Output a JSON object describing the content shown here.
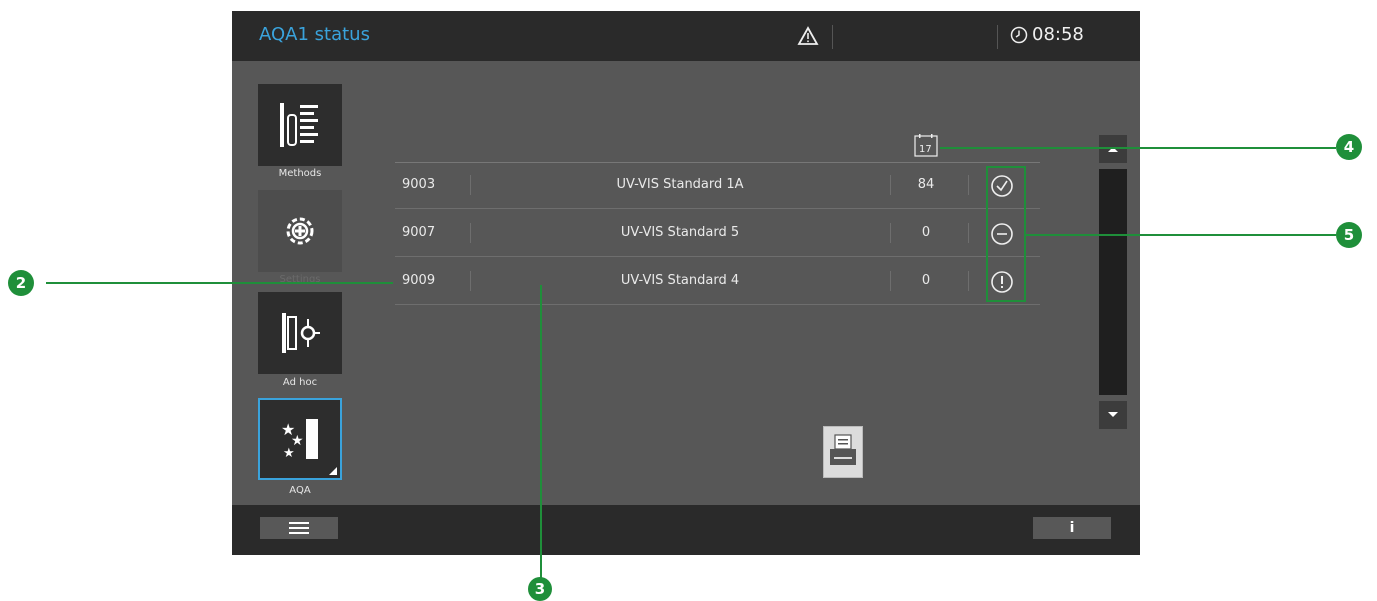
{
  "header": {
    "title": "AQA1 status",
    "time": "08:58",
    "warning_icon": "warning-triangle-icon",
    "clock_icon": "clock-icon"
  },
  "sidebar": {
    "items": [
      {
        "label": "Methods",
        "icon": "methods-icon"
      },
      {
        "label": "Settings",
        "icon": "settings-gear-icon"
      },
      {
        "label": "Ad hoc",
        "icon": "ad-hoc-icon"
      },
      {
        "label": "AQA",
        "icon": "aqa-stars-icon",
        "active": true
      }
    ]
  },
  "table": {
    "date_header": "17",
    "rows": [
      {
        "id": "9003",
        "name": "UV-VIS Standard 1A",
        "days": "84",
        "status": "ok"
      },
      {
        "id": "9007",
        "name": "UV-VIS Standard 5",
        "days": "0",
        "status": "inactive"
      },
      {
        "id": "9009",
        "name": "UV-VIS Standard 4",
        "days": "0",
        "status": "warning"
      }
    ]
  },
  "footer": {
    "info_label": "i"
  },
  "callouts": {
    "c2": "2",
    "c3": "3",
    "c4": "4",
    "c5": "5"
  },
  "colors": {
    "accent": "#3aa3dc",
    "callout": "#1f8f3a"
  }
}
